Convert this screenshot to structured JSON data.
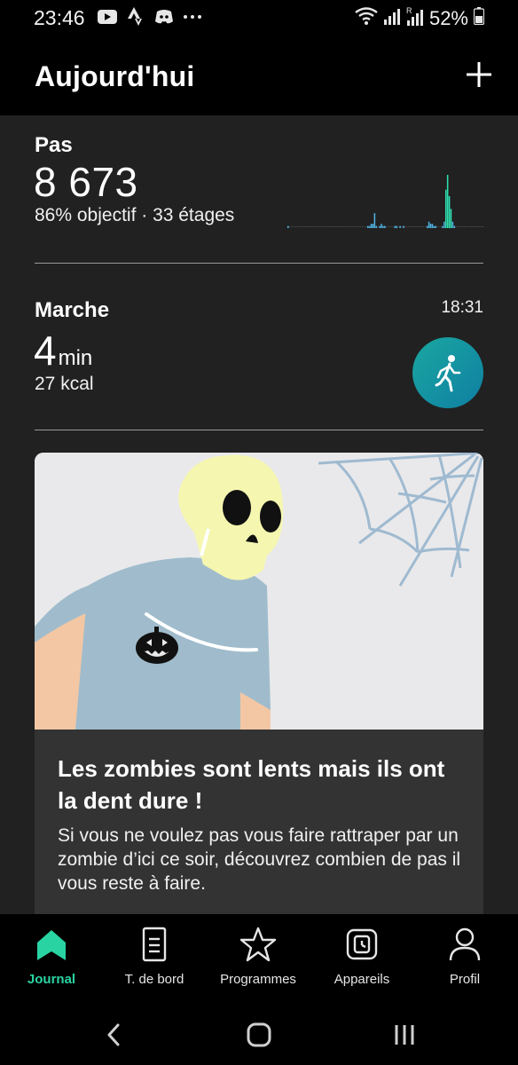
{
  "status_bar": {
    "time": "23:46",
    "battery": "52%",
    "icons": [
      "youtube-icon",
      "strava-icon",
      "discord-icon",
      "more-dots-icon",
      "wifi-icon",
      "signal-icon",
      "signal-roaming-icon",
      "battery-icon"
    ]
  },
  "header": {
    "title": "Aujourd'hui",
    "add_icon": "plus-icon"
  },
  "steps": {
    "label": "Pas",
    "value": "8 673",
    "sub": "86% objectif · 33 étages",
    "bar_colors": {
      "low": "#4fb3e3",
      "high": "#2fe0b1",
      "dot": "#555555"
    }
  },
  "chart_data": {
    "type": "bar",
    "title": "",
    "values": [
      1,
      0,
      0,
      0,
      0,
      0,
      0,
      0,
      0,
      0,
      0,
      0,
      0,
      0,
      0,
      0,
      0,
      0,
      0,
      0,
      0,
      0,
      0,
      0,
      0,
      0,
      0,
      0,
      0,
      0,
      0,
      0,
      0,
      0,
      0,
      0,
      0,
      0,
      0,
      0,
      0,
      0,
      0,
      0,
      0,
      0,
      0,
      1,
      1,
      2,
      2,
      7,
      1,
      0,
      1,
      2,
      1,
      1,
      0,
      0,
      0,
      0,
      0,
      1,
      1,
      0,
      1,
      0,
      1,
      0,
      0,
      0,
      0,
      0,
      0,
      0,
      0,
      0,
      0,
      0,
      0,
      0,
      1,
      3,
      2,
      2,
      1,
      1,
      0,
      0,
      0,
      1,
      3,
      18,
      25,
      15,
      9,
      3,
      1,
      0,
      0,
      0,
      0,
      0,
      0,
      0,
      0,
      0,
      0,
      0,
      0,
      0,
      0,
      0,
      0,
      0
    ],
    "scale_max": 25
  },
  "walk": {
    "label": "Marche",
    "time": "18:31",
    "duration_num": "4",
    "duration_unit": "min",
    "kcal": "27 kcal",
    "icon": "walking-person-icon"
  },
  "card": {
    "title": "Les zombies sont lents mais ils ont la dent dure !",
    "body": "Si vous ne voulez pas vous faire rattraper par un zombie d’ici ce soir, découvrez combien de pas il vous reste à faire."
  },
  "bottom_nav": {
    "items": [
      {
        "label": "Journal",
        "icon": "home-icon",
        "active": true
      },
      {
        "label": "T. de bord",
        "icon": "document-icon",
        "active": false
      },
      {
        "label": "Programmes",
        "icon": "star-icon",
        "active": false
      },
      {
        "label": "Appareils",
        "icon": "watch-icon",
        "active": false
      },
      {
        "label": "Profil",
        "icon": "profile-icon",
        "active": false
      }
    ],
    "active_color": "#29d3a2"
  },
  "system_nav": [
    "back-icon",
    "home-button-icon",
    "recents-icon"
  ]
}
